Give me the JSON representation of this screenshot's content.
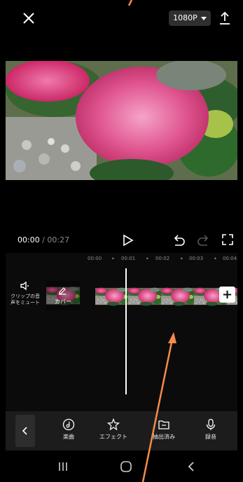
{
  "topbar": {
    "resolution_label": "1080P",
    "close_icon": "close-icon",
    "export_icon": "upload-icon"
  },
  "player": {
    "current_time": "00:00",
    "separator": " / ",
    "total_time": "00:27"
  },
  "timeline": {
    "ruler": [
      "00:00",
      "00:01",
      "00:02",
      "00:03",
      "00:04"
    ],
    "ruler_dot": "•",
    "mute_label_line1": "クリップの音",
    "mute_label_line2": "声をミュート",
    "cover_label": "カバー",
    "add_label": "+"
  },
  "toolbar": {
    "items": [
      {
        "label": "楽曲",
        "icon": "music-note-icon"
      },
      {
        "label": "エフェクト",
        "icon": "effect-star-icon"
      },
      {
        "label": "抽出済み",
        "icon": "folder-icon"
      },
      {
        "label": "録音",
        "icon": "microphone-icon"
      }
    ]
  },
  "colors": {
    "background": "#000000",
    "toolbar": "#1c1c1c",
    "annotation_arrow": "#f58c4a"
  }
}
